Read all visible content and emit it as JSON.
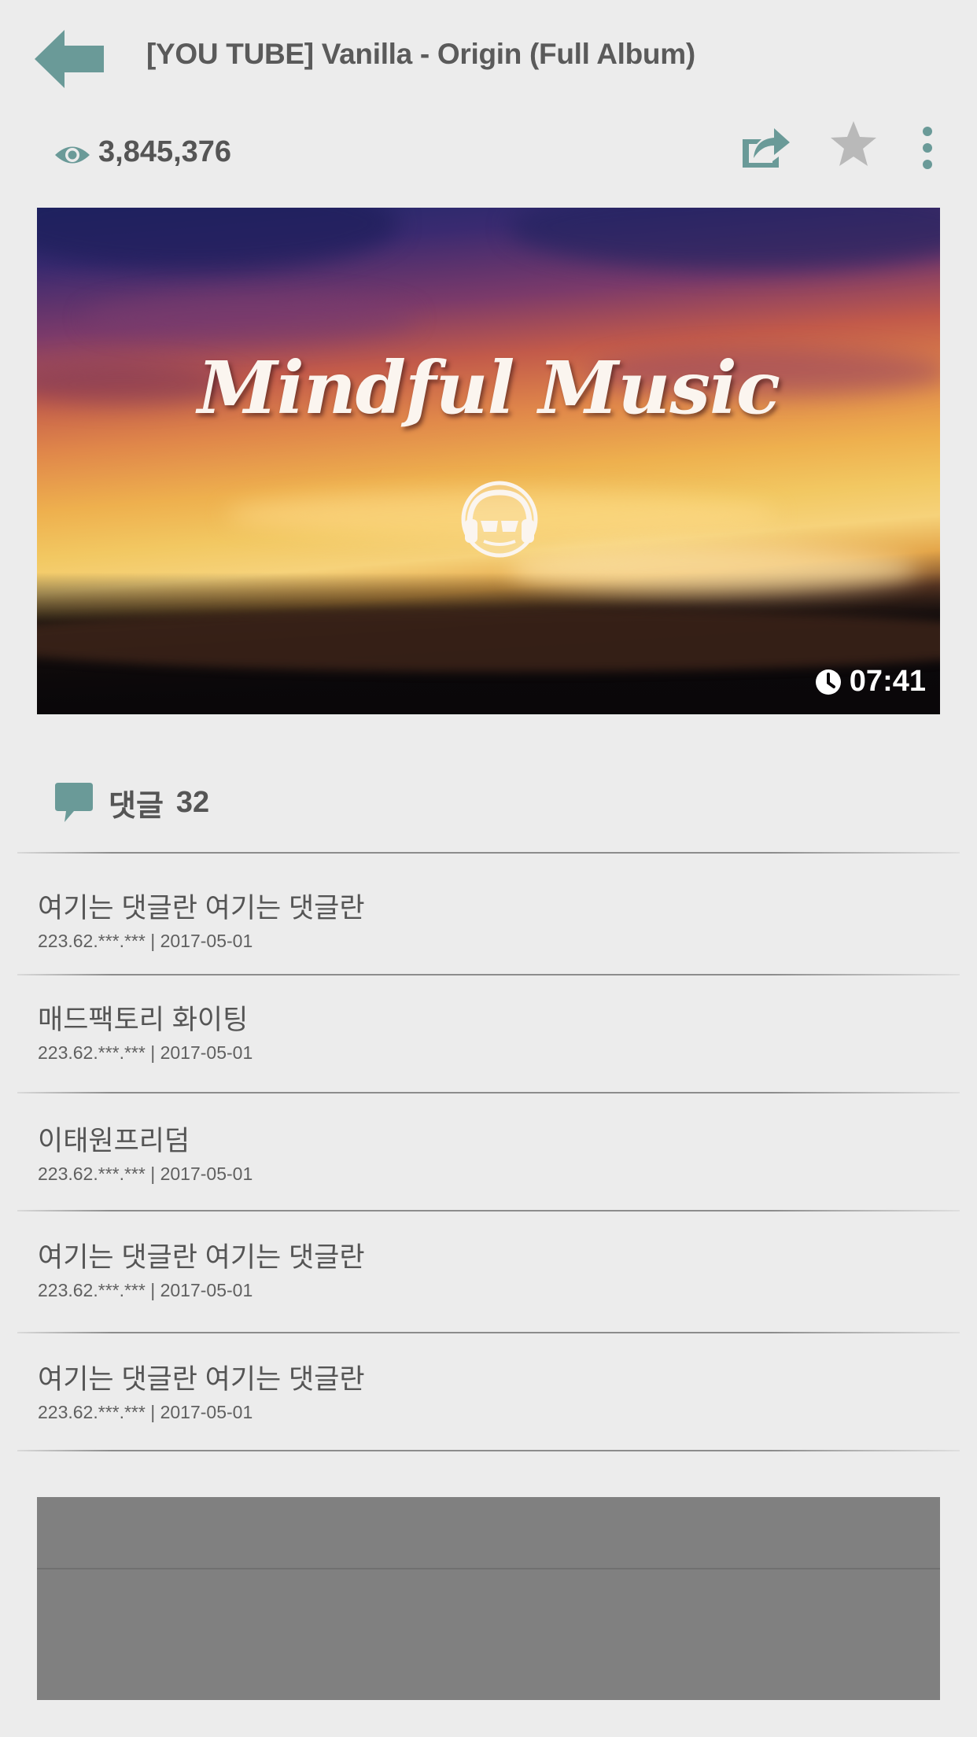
{
  "header": {
    "title": "[YOU TUBE] Vanilla - Origin (Full Album)"
  },
  "stats": {
    "views": "3,845,376"
  },
  "video": {
    "thumbnail_title": "Mindful Music",
    "duration": "07:41"
  },
  "comments": {
    "label": "댓글",
    "count": "32",
    "items": [
      {
        "text": "여기는 댓글란 여기는 댓글란",
        "meta": "223.62.***.*** | 2017-05-01"
      },
      {
        "text": "매드팩토리 화이팅",
        "meta": "223.62.***.*** | 2017-05-01"
      },
      {
        "text": "이태원프리덤",
        "meta": "223.62.***.*** | 2017-05-01"
      },
      {
        "text": "여기는 댓글란 여기는 댓글란",
        "meta": "223.62.***.*** | 2017-05-01"
      },
      {
        "text": "여기는 댓글란 여기는 댓글란",
        "meta": "223.62.***.*** | 2017-05-01"
      }
    ]
  },
  "icons": {
    "back": "arrow-left-icon",
    "views": "eye-icon",
    "share": "share-icon",
    "favorite": "star-icon",
    "more": "more-vertical-icon",
    "duration": "clock-icon",
    "comments": "speech-bubble-icon"
  },
  "colors": {
    "accent": "#6a9a98",
    "star": "#b9b9b9",
    "background": "#ececec",
    "ad": "#808080"
  }
}
